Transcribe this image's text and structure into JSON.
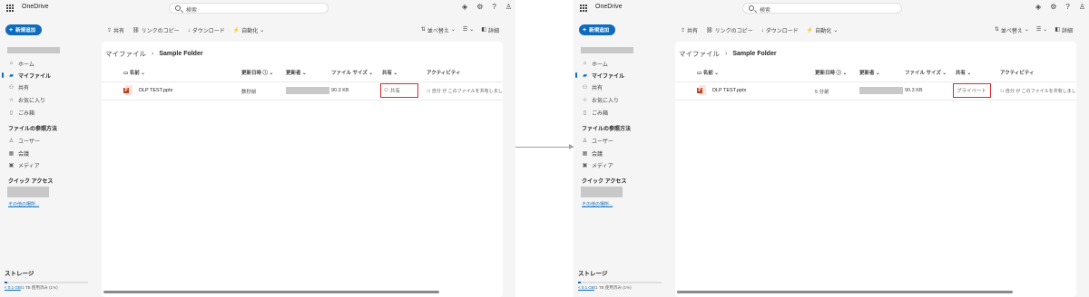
{
  "app": {
    "name": "OneDrive"
  },
  "search": {
    "placeholder": "検索"
  },
  "header_icons": [
    "diamond-icon",
    "gear-icon",
    "help-icon",
    "person-icon"
  ],
  "new_button": {
    "label": "新規追加"
  },
  "commands": {
    "share": "共有",
    "copy_link": "リンクのコピー",
    "download": "ダウンロード",
    "automate": "自動化",
    "sort": "並べ替え",
    "view": "",
    "details": "詳細"
  },
  "nav": {
    "home": "ホーム",
    "my_files": "マイファイル",
    "shared": "共有",
    "favorites": "お気に入り",
    "recycle": "ごみ箱",
    "browse_heading": "ファイルの参照方法",
    "people": "ユーザー",
    "meetings": "会議",
    "media": "メディア",
    "quick_access": "クイック アクセス",
    "more_places": "その他の場所..."
  },
  "storage": {
    "heading": "ストレージ",
    "used_link": "< 0.1 GB",
    "used_rest": "/1 TB 使用済み (1%)",
    "used_percent": 1
  },
  "breadcrumb": {
    "root": "マイファイル",
    "current": "Sample Folder"
  },
  "columns": {
    "name": "名前",
    "modified": "更新日時",
    "modified_by": "更新者",
    "size": "ファイル サイズ",
    "sharing": "共有",
    "activity": "アクティビティ"
  },
  "before": {
    "file": {
      "name": "DLP TEST.pptx",
      "modified": "数秒前",
      "size": "90.3 KB",
      "sharing": "共有",
      "activity": "自分 が このファイルを共有しまし"
    }
  },
  "after": {
    "file": {
      "name": "DLP TEST.pptx",
      "modified": "5 分前",
      "size": "90.3 KB",
      "sharing": "プライベート",
      "activity": "自分 が このファイルを共有しまし"
    }
  },
  "colors": {
    "accent": "#0f6cbd",
    "highlight": "#d32f2f",
    "ppt": "#c43e1c"
  }
}
